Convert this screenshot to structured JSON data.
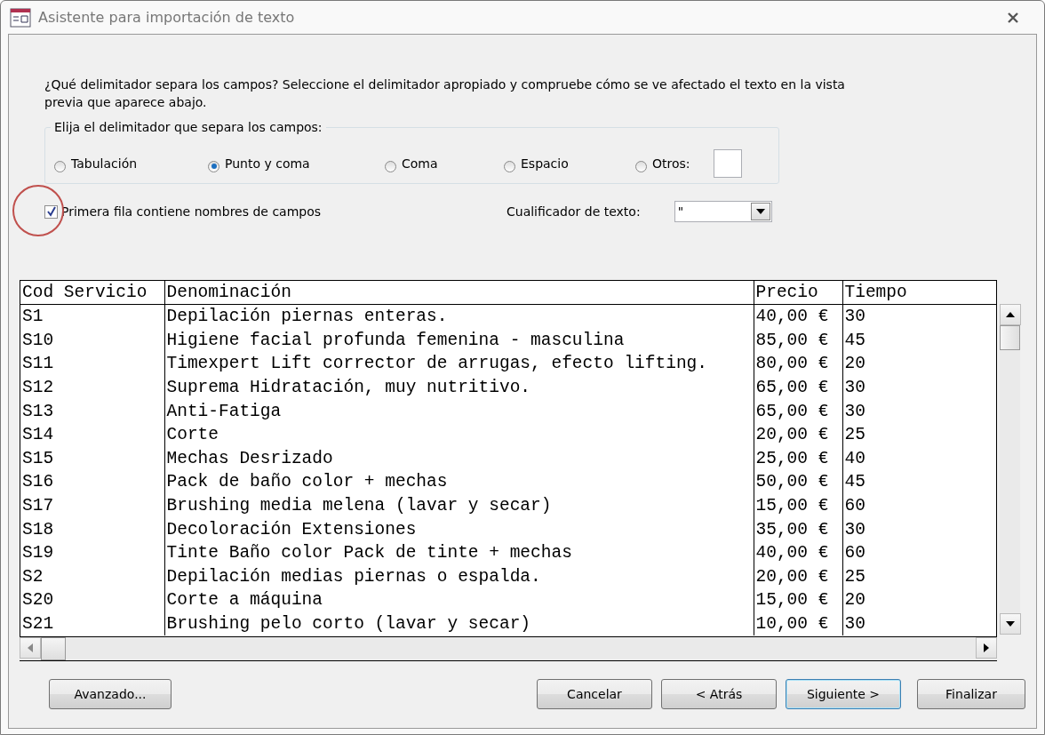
{
  "window": {
    "title": "Asistente para importación de texto"
  },
  "instructions": "¿Qué delimitador separa los campos? Seleccione el delimitador apropiado y compruebe cómo se ve afectado el texto en la vista previa que aparece abajo.",
  "delimiter_group": {
    "legend": "Elija el delimitador que separa los campos:",
    "options": [
      {
        "label": "Tabulación",
        "selected": false
      },
      {
        "label": "Punto y coma",
        "selected": true
      },
      {
        "label": "Coma",
        "selected": false
      },
      {
        "label": "Espacio",
        "selected": false
      },
      {
        "label": "Otros:",
        "selected": false
      }
    ]
  },
  "first_row_names": {
    "label": "Primera fila contiene nombres de campos",
    "checked": true
  },
  "text_qualifier": {
    "label": "Cualificador de texto:",
    "value": "\""
  },
  "table": {
    "columns": [
      "Cod Servicio",
      "Denominación",
      "Precio",
      "Tiempo"
    ],
    "rows": [
      [
        "S1",
        "Depilación piernas enteras.",
        "40,00 €",
        "30"
      ],
      [
        "S10",
        "Higiene facial profunda femenina - masculina",
        "85,00 €",
        "45"
      ],
      [
        "S11",
        "Timexpert Lift corrector de arrugas, efecto lifting.",
        "80,00 €",
        "20"
      ],
      [
        "S12",
        "Suprema Hidratación, muy nutritivo.",
        "65,00 €",
        "30"
      ],
      [
        "S13",
        "Anti-Fatiga",
        "65,00 €",
        "30"
      ],
      [
        "S14",
        "Corte",
        "20,00 €",
        "25"
      ],
      [
        "S15",
        "Mechas Desrizado",
        "25,00 €",
        "40"
      ],
      [
        "S16",
        "Pack de baño color + mechas",
        "50,00 €",
        "45"
      ],
      [
        "S17",
        "Brushing media melena (lavar y secar)",
        "15,00 €",
        "60"
      ],
      [
        "S18",
        "Decoloración Extensiones",
        "35,00 €",
        "30"
      ],
      [
        "S19",
        "Tinte Baño color Pack de tinte + mechas",
        "40,00 €",
        "60"
      ],
      [
        "S2",
        "Depilación medias piernas o espalda.",
        "20,00 €",
        "25"
      ],
      [
        "S20",
        "Corte a máquina",
        "15,00 €",
        "20"
      ],
      [
        "S21",
        "Brushing pelo corto (lavar y secar)",
        "10,00 €",
        "30"
      ]
    ]
  },
  "buttons": [
    {
      "label": "Avanzado...",
      "default": false
    },
    {
      "label": "Cancelar",
      "default": false
    },
    {
      "label": "< Atrás",
      "default": false
    },
    {
      "label": "Siguiente >",
      "default": true
    },
    {
      "label": "Finalizar",
      "default": false
    }
  ]
}
